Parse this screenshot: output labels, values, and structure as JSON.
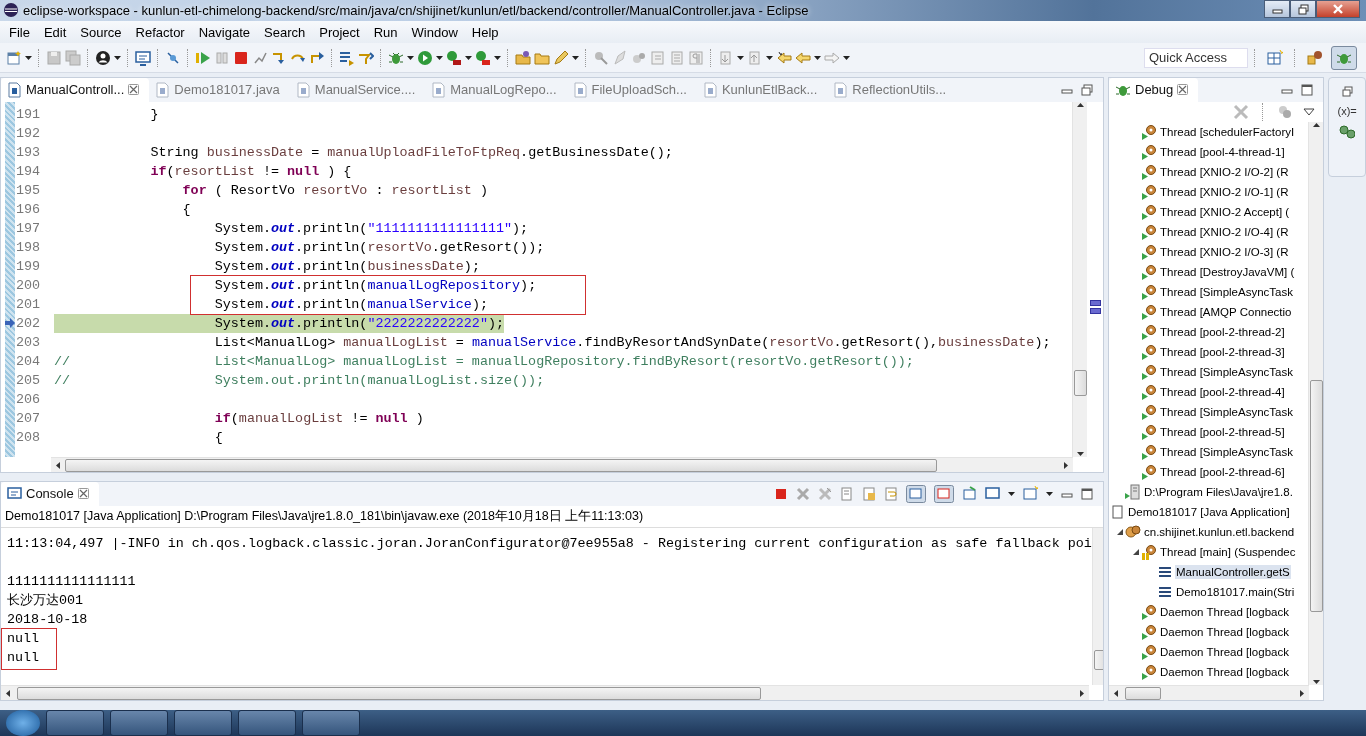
{
  "window": {
    "title": "eclipse-workspace - kunlun-etl-chimelong-backend/src/main/java/cn/shijinet/kunlun/etl/backend/controller/ManualController.java - Eclipse"
  },
  "menu": [
    "File",
    "Edit",
    "Source",
    "Refactor",
    "Navigate",
    "Search",
    "Project",
    "Run",
    "Window",
    "Help"
  ],
  "quick_access": {
    "placeholder": "Quick Access"
  },
  "editor": {
    "tabs": [
      {
        "label": "ManualControll...",
        "selected": true
      },
      {
        "label": "Demo181017.java",
        "selected": false
      },
      {
        "label": "ManualService....",
        "selected": false
      },
      {
        "label": "ManualLogRepo...",
        "selected": false
      },
      {
        "label": "FileUploadSch...",
        "selected": false
      },
      {
        "label": "KunlunEtlBack...",
        "selected": false
      },
      {
        "label": "ReflectionUtils...",
        "selected": false
      }
    ],
    "lines": [
      {
        "number": "191",
        "current": false,
        "outlined": false,
        "tokens": [
          {
            "kind": "plain",
            "text": "            }"
          }
        ]
      },
      {
        "number": "192",
        "current": false,
        "outlined": false
      },
      {
        "number": "193",
        "current": false,
        "outlined": false,
        "tokens": [
          {
            "kind": "plain",
            "text": "            String "
          },
          {
            "kind": "variable",
            "text": "businessDate"
          },
          {
            "kind": "plain",
            "text": " = "
          },
          {
            "kind": "variable",
            "text": "manualUploadFileToFtpReq"
          },
          {
            "kind": "plain",
            "text": ".getBusinessDate();"
          }
        ]
      },
      {
        "number": "194",
        "current": false,
        "outlined": false,
        "tokens": [
          {
            "kind": "keyword",
            "text": "            if"
          },
          {
            "kind": "plain",
            "text": "("
          },
          {
            "kind": "variable",
            "text": "resortList"
          },
          {
            "kind": "plain",
            "text": " != "
          },
          {
            "kind": "keyword",
            "text": "null"
          },
          {
            "kind": "plain",
            "text": " ) {"
          }
        ]
      },
      {
        "number": "195",
        "current": false,
        "outlined": false,
        "tokens": [
          {
            "kind": "keyword",
            "text": "                for"
          },
          {
            "kind": "plain",
            "text": " ( ResortVo "
          },
          {
            "kind": "variable",
            "text": "resortVo"
          },
          {
            "kind": "plain",
            "text": " : "
          },
          {
            "kind": "variable",
            "text": "resortList"
          },
          {
            "kind": "plain",
            "text": " )"
          }
        ]
      },
      {
        "number": "196",
        "current": false,
        "outlined": false,
        "tokens": [
          {
            "kind": "plain",
            "text": "                {"
          }
        ]
      },
      {
        "number": "197",
        "current": false,
        "outlined": false,
        "tokens": [
          {
            "kind": "plain",
            "text": "                    System."
          },
          {
            "kind": "static_field",
            "text": "out"
          },
          {
            "kind": "plain",
            "text": ".println("
          },
          {
            "kind": "string",
            "text": "\"1111111111111111\""
          },
          {
            "kind": "plain",
            "text": ");"
          }
        ]
      },
      {
        "number": "198",
        "current": false,
        "outlined": false,
        "tokens": [
          {
            "kind": "plain",
            "text": "                    System."
          },
          {
            "kind": "static_field",
            "text": "out"
          },
          {
            "kind": "plain",
            "text": ".println("
          },
          {
            "kind": "variable",
            "text": "resortVo"
          },
          {
            "kind": "plain",
            "text": ".getResort());"
          }
        ]
      },
      {
        "number": "199",
        "current": false,
        "outlined": false,
        "tokens": [
          {
            "kind": "plain",
            "text": "                    System."
          },
          {
            "kind": "static_field",
            "text": "out"
          },
          {
            "kind": "plain",
            "text": ".println("
          },
          {
            "kind": "variable",
            "text": "businessDate"
          },
          {
            "kind": "plain",
            "text": ");"
          }
        ]
      },
      {
        "number": "200",
        "current": false,
        "outlined": true,
        "tokens": [
          {
            "kind": "plain",
            "text": "                    System."
          },
          {
            "kind": "static_field",
            "text": "out"
          },
          {
            "kind": "plain",
            "text": ".println("
          },
          {
            "kind": "field",
            "text": "manualLogRepository"
          },
          {
            "kind": "plain",
            "text": ");"
          }
        ]
      },
      {
        "number": "201",
        "current": false,
        "outlined": true,
        "tokens": [
          {
            "kind": "plain",
            "text": "                    System."
          },
          {
            "kind": "static_field",
            "text": "out"
          },
          {
            "kind": "plain",
            "text": ".println("
          },
          {
            "kind": "field",
            "text": "manualService"
          },
          {
            "kind": "plain",
            "text": ");"
          }
        ]
      },
      {
        "number": "202",
        "current": true,
        "outlined": false,
        "tokens": [
          {
            "kind": "plain",
            "text": "                    System."
          },
          {
            "kind": "static_field",
            "text": "out"
          },
          {
            "kind": "plain",
            "text": ".println("
          },
          {
            "kind": "string",
            "text": "\"2222222222222\""
          },
          {
            "kind": "plain",
            "text": ");"
          }
        ]
      },
      {
        "number": "203",
        "current": false,
        "outlined": false,
        "tokens": [
          {
            "kind": "plain",
            "text": "                    List<ManualLog> "
          },
          {
            "kind": "variable",
            "text": "manualLogList"
          },
          {
            "kind": "plain",
            "text": " = "
          },
          {
            "kind": "field",
            "text": "manualService"
          },
          {
            "kind": "plain",
            "text": ".findByResortAndSynDate("
          },
          {
            "kind": "variable",
            "text": "resortVo"
          },
          {
            "kind": "plain",
            "text": ".getResort(),"
          },
          {
            "kind": "variable",
            "text": "businessDate"
          },
          {
            "kind": "plain",
            "text": ");"
          }
        ]
      },
      {
        "number": "204",
        "current": false,
        "outlined": false,
        "tokens": [
          {
            "kind": "comment",
            "text": "//                  List<ManualLog> manualLogList = manualLogRepository.findByResort(resortVo.getResort());"
          }
        ]
      },
      {
        "number": "205",
        "current": false,
        "outlined": false,
        "tokens": [
          {
            "kind": "comment",
            "text": "//                  System.out.println(manualLogList.size());"
          }
        ]
      },
      {
        "number": "206",
        "current": false,
        "outlined": false
      },
      {
        "number": "207",
        "current": false,
        "outlined": false,
        "tokens": [
          {
            "kind": "keyword",
            "text": "                    if"
          },
          {
            "kind": "plain",
            "text": "("
          },
          {
            "kind": "variable",
            "text": "manualLogList"
          },
          {
            "kind": "plain",
            "text": " != "
          },
          {
            "kind": "keyword",
            "text": "null"
          },
          {
            "kind": "plain",
            "text": " )"
          }
        ]
      },
      {
        "number": "208",
        "current": false,
        "outlined": false,
        "tokens": [
          {
            "kind": "plain",
            "text": "                    {"
          }
        ]
      }
    ]
  },
  "console": {
    "tab": "Console",
    "header": "Demo181017 [Java Application] D:\\Program Files\\Java\\jre1.8.0_181\\bin\\javaw.exe (2018年10月18日 上午11:13:03)",
    "lines": [
      {
        "text": "11:13:04,497 |-INFO in ch.qos.logback.classic.joran.JoranConfigurator@7ee955a8 - Registering current configuration as safe fallback poi",
        "outlined": false
      },
      {
        "outlined": false
      },
      {
        "text": "1111111111111111",
        "outlined": false
      },
      {
        "text": "长沙万达001",
        "outlined": false
      },
      {
        "text": "2018-10-18",
        "outlined": false
      },
      {
        "text": "null",
        "outlined": true
      },
      {
        "text": "null",
        "outlined": true
      }
    ]
  },
  "debug": {
    "tab": "Debug",
    "tree": [
      {
        "children": [
          {
            "children": [
              {
                "text": "Thread [schedulerFactoryI",
                "kind": "thread",
                "selected": false
              },
              {
                "text": "Thread [pool-4-thread-1]",
                "kind": "thread",
                "selected": false
              },
              {
                "text": "Thread [XNIO-2 I/O-2] (R",
                "kind": "thread",
                "selected": false
              },
              {
                "text": "Thread [XNIO-2 I/O-1] (R",
                "kind": "thread",
                "selected": false
              },
              {
                "text": "Thread [XNIO-2 Accept] (",
                "kind": "thread",
                "selected": false
              },
              {
                "text": "Thread [XNIO-2 I/O-4] (R",
                "kind": "thread",
                "selected": false
              },
              {
                "text": "Thread [XNIO-2 I/O-3] (R",
                "kind": "thread",
                "selected": false
              },
              {
                "text": "Thread [DestroyJavaVM] (",
                "kind": "thread",
                "selected": false
              },
              {
                "text": "Thread [SimpleAsyncTask",
                "kind": "thread",
                "selected": false
              },
              {
                "text": "Thread [AMQP Connectio",
                "kind": "thread",
                "selected": false
              },
              {
                "text": "Thread [pool-2-thread-2]",
                "kind": "thread",
                "selected": false
              },
              {
                "text": "Thread [pool-2-thread-3]",
                "kind": "thread",
                "selected": false
              },
              {
                "text": "Thread [SimpleAsyncTask",
                "kind": "thread",
                "selected": false
              },
              {
                "text": "Thread [pool-2-thread-4]",
                "kind": "thread",
                "selected": false
              },
              {
                "text": "Thread [SimpleAsyncTask",
                "kind": "thread",
                "selected": false
              },
              {
                "text": "Thread [pool-2-thread-5]",
                "kind": "thread",
                "selected": false
              },
              {
                "text": "Thread [SimpleAsyncTask",
                "kind": "thread",
                "selected": false
              },
              {
                "text": "Thread [pool-2-thread-6]",
                "kind": "thread",
                "selected": false
              }
            ]
          },
          {
            "text": "D:\\Program Files\\Java\\jre1.8.",
            "kind": "process",
            "selected": false
          }
        ]
      },
      {
        "text": "Demo181017 [Java Application]",
        "kind": "launch",
        "selected": false,
        "children": [
          {
            "text": "cn.shijinet.kunlun.etl.backend",
            "kind": "target",
            "selected": false,
            "expanded": true,
            "children": [
              {
                "text": "Thread [main] (Suspendec",
                "kind": "suspended_thread",
                "selected": false,
                "expanded": true,
                "children": [
                  {
                    "text": "ManualController.getS",
                    "kind": "frame",
                    "selected": true
                  },
                  {
                    "text": "Demo181017.main(Stri",
                    "kind": "frame",
                    "selected": false
                  }
                ]
              },
              {
                "text": "Daemon Thread [logback",
                "kind": "thread",
                "selected": false
              },
              {
                "text": "Daemon Thread [logback",
                "kind": "thread",
                "selected": false
              },
              {
                "text": "Daemon Thread [logback",
                "kind": "thread",
                "selected": false
              },
              {
                "text": "Daemon Thread [logback",
                "kind": "thread",
                "selected": false
              }
            ]
          }
        ]
      }
    ]
  },
  "side_strip": {
    "variables_label": "(x)="
  }
}
